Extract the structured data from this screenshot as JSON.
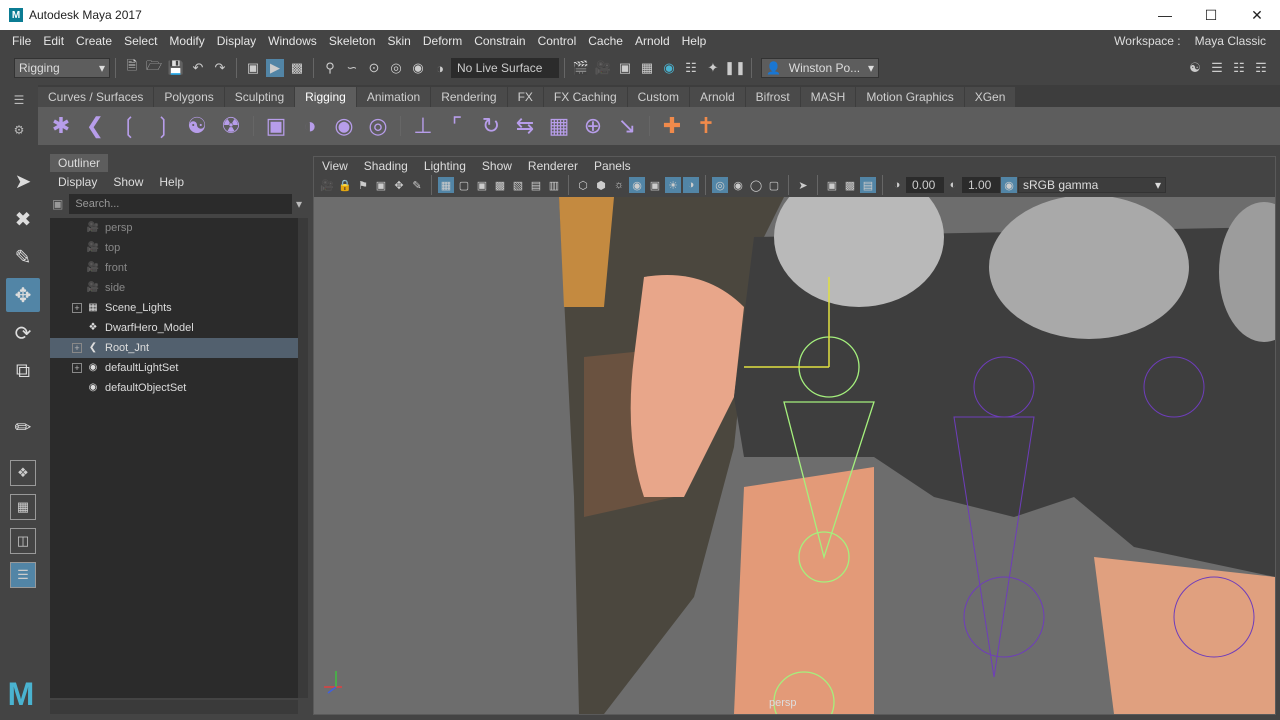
{
  "window": {
    "title": "Autodesk Maya 2017",
    "min_icon": "minimize-icon",
    "max_icon": "maximize-icon",
    "close_icon": "close-icon"
  },
  "menu": [
    "File",
    "Edit",
    "Create",
    "Select",
    "Modify",
    "Display",
    "Windows",
    "Skeleton",
    "Skin",
    "Deform",
    "Constrain",
    "Control",
    "Cache",
    "Arnold",
    "Help"
  ],
  "workspace": {
    "label": "Workspace :",
    "value": "Maya Classic"
  },
  "status": {
    "menuset": "Rigging",
    "live_surface": "No Live Surface",
    "user": "Winston Po..."
  },
  "shelf_tabs": [
    "Curves / Surfaces",
    "Polygons",
    "Sculpting",
    "Rigging",
    "Animation",
    "Rendering",
    "FX",
    "FX Caching",
    "Custom",
    "Arnold",
    "Bifrost",
    "MASH",
    "Motion Graphics",
    "XGen"
  ],
  "shelf_active": "Rigging",
  "outliner": {
    "title": "Outliner",
    "menu": [
      "Display",
      "Show",
      "Help"
    ],
    "search_placeholder": "Search...",
    "items": [
      {
        "label": "persp",
        "dim": true,
        "expand": false
      },
      {
        "label": "top",
        "dim": true,
        "expand": false
      },
      {
        "label": "front",
        "dim": true,
        "expand": false
      },
      {
        "label": "side",
        "dim": true,
        "expand": false
      },
      {
        "label": "Scene_Lights",
        "dim": false,
        "expand": true
      },
      {
        "label": "DwarfHero_Model",
        "dim": false,
        "expand": false
      },
      {
        "label": "Root_Jnt",
        "dim": false,
        "expand": true,
        "selected": true
      },
      {
        "label": "defaultLightSet",
        "dim": false,
        "expand": true
      },
      {
        "label": "defaultObjectSet",
        "dim": false,
        "expand": false
      }
    ]
  },
  "viewport": {
    "menu": [
      "View",
      "Shading",
      "Lighting",
      "Show",
      "Renderer",
      "Panels"
    ],
    "exposure": "0.00",
    "gamma": "1.00",
    "color_space": "sRGB gamma",
    "camera": "persp"
  }
}
